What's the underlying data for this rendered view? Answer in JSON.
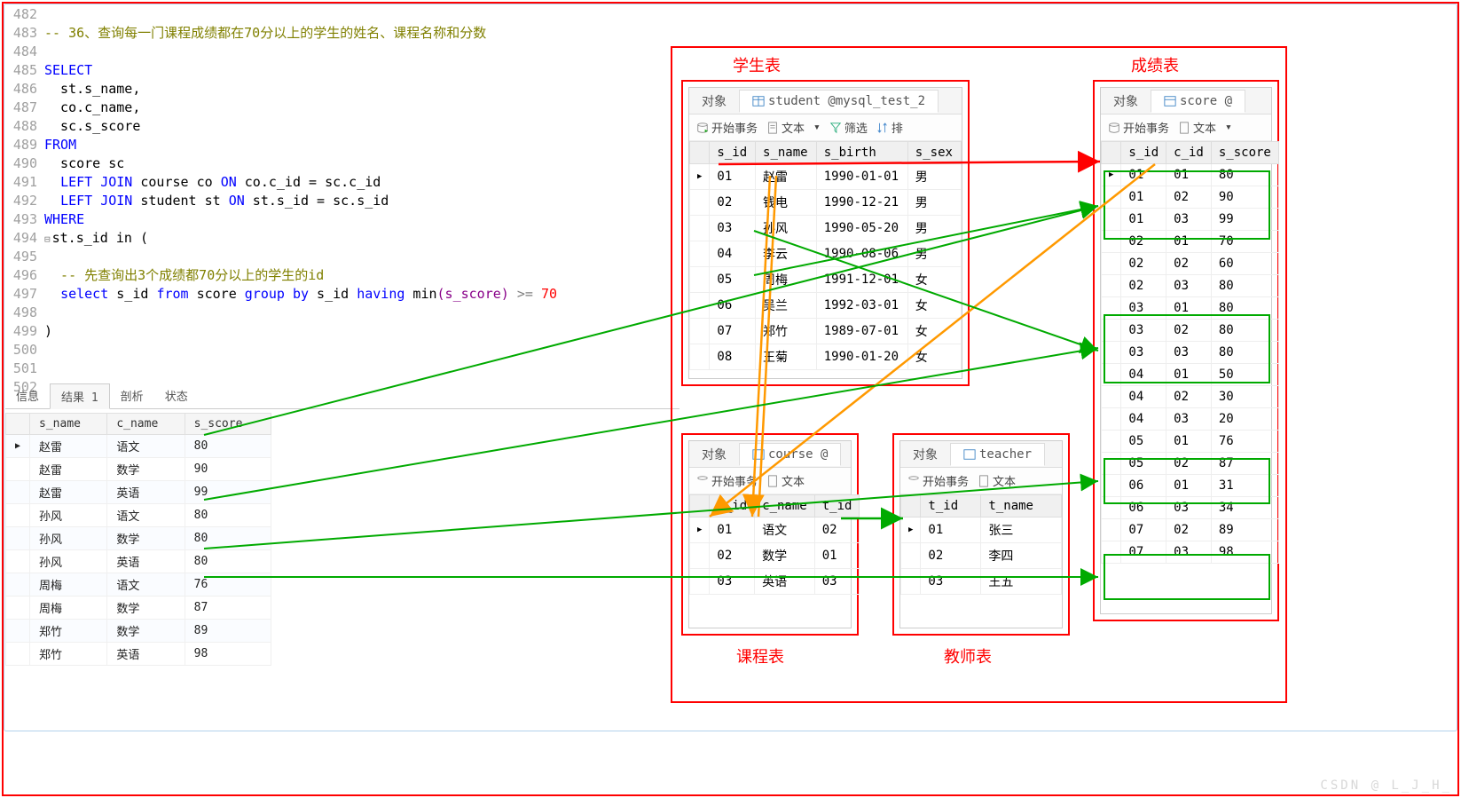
{
  "code": {
    "lines": [
      {
        "n": "482",
        "t": "",
        "cls": ""
      },
      {
        "n": "483",
        "t": "-- 36、查询每一门课程成绩都在70分以上的学生的姓名、课程名称和分数",
        "cls": "cm"
      },
      {
        "n": "484",
        "t": "",
        "cls": ""
      },
      {
        "n": "485",
        "t": "SELECT",
        "cls": "kw"
      },
      {
        "n": "486",
        "t": "  st.s_name,",
        "cls": ""
      },
      {
        "n": "487",
        "t": "  co.c_name,",
        "cls": ""
      },
      {
        "n": "488",
        "t": "  sc.s_score",
        "cls": ""
      },
      {
        "n": "489",
        "t": "FROM",
        "cls": "kw"
      },
      {
        "n": "490",
        "t": "  score sc",
        "cls": ""
      },
      {
        "n": "491",
        "pre": "  ",
        "kw1": "LEFT JOIN",
        "mid": " course co ",
        "kw2": "ON",
        "post": " co.c_id = sc.c_id"
      },
      {
        "n": "492",
        "pre": "  ",
        "kw1": "LEFT JOIN",
        "mid": " student st ",
        "kw2": "ON",
        "post": " st.s_id = sc.s_id"
      },
      {
        "n": "493",
        "t": "WHERE",
        "cls": "kw"
      },
      {
        "n": "494",
        "t": "st.s_id in (",
        "cls": "",
        "collapse": true
      },
      {
        "n": "495",
        "t": "",
        "cls": ""
      },
      {
        "n": "496",
        "t": "  -- 先查询出3个成绩都70分以上的学生的id",
        "cls": "cm"
      },
      {
        "n": "497",
        "sel": true
      },
      {
        "n": "498",
        "t": "",
        "cls": ""
      },
      {
        "n": "499",
        "t": ")",
        "cls": ""
      },
      {
        "n": "500",
        "t": "",
        "cls": ""
      },
      {
        "n": "501",
        "t": "",
        "cls": ""
      },
      {
        "n": "502",
        "t": "",
        "cls": ""
      }
    ],
    "sel_line": {
      "select": "select",
      "s_id": " s_id ",
      "from": "from",
      "score": " score ",
      "group": "group by",
      "s_id2": " s_id ",
      "having": "having",
      "min": " min",
      "paren": "(s_score) ",
      "gte": ">= ",
      "num": "70"
    }
  },
  "tabs": {
    "info": "信息",
    "result1": "结果 1",
    "profile": "剖析",
    "status": "状态"
  },
  "result": {
    "headers": [
      "s_name",
      "c_name",
      "s_score"
    ],
    "rows": [
      [
        "赵雷",
        "语文",
        "80"
      ],
      [
        "赵雷",
        "数学",
        "90"
      ],
      [
        "赵雷",
        "英语",
        "99"
      ],
      [
        "孙风",
        "语文",
        "80"
      ],
      [
        "孙风",
        "数学",
        "80"
      ],
      [
        "孙风",
        "英语",
        "80"
      ],
      [
        "周梅",
        "语文",
        "76"
      ],
      [
        "周梅",
        "数学",
        "87"
      ],
      [
        "郑竹",
        "数学",
        "89"
      ],
      [
        "郑竹",
        "英语",
        "98"
      ]
    ]
  },
  "labels": {
    "student": "学生表",
    "score": "成绩表",
    "course": "课程表",
    "teacher": "教师表",
    "obj": "对象",
    "start_tx": "开始事务",
    "text": "文本",
    "filter": "筛选",
    "sort": "排"
  },
  "student_panel": {
    "tab": "student @mysql_test_2",
    "headers": [
      "s_id",
      "s_name",
      "s_birth",
      "s_sex"
    ],
    "rows": [
      [
        "01",
        "赵雷",
        "1990-01-01",
        "男"
      ],
      [
        "02",
        "钱电",
        "1990-12-21",
        "男"
      ],
      [
        "03",
        "孙风",
        "1990-05-20",
        "男"
      ],
      [
        "04",
        "李云",
        "1990-08-06",
        "男"
      ],
      [
        "05",
        "周梅",
        "1991-12-01",
        "女"
      ],
      [
        "06",
        "吴兰",
        "1992-03-01",
        "女"
      ],
      [
        "07",
        "郑竹",
        "1989-07-01",
        "女"
      ],
      [
        "08",
        "王菊",
        "1990-01-20",
        "女"
      ]
    ]
  },
  "score_panel": {
    "tab": "score @",
    "headers": [
      "s_id",
      "c_id",
      "s_score"
    ],
    "rows": [
      [
        "01",
        "01",
        "80"
      ],
      [
        "01",
        "02",
        "90"
      ],
      [
        "01",
        "03",
        "99"
      ],
      [
        "02",
        "01",
        "70"
      ],
      [
        "02",
        "02",
        "60"
      ],
      [
        "02",
        "03",
        "80"
      ],
      [
        "03",
        "01",
        "80"
      ],
      [
        "03",
        "02",
        "80"
      ],
      [
        "03",
        "03",
        "80"
      ],
      [
        "04",
        "01",
        "50"
      ],
      [
        "04",
        "02",
        "30"
      ],
      [
        "04",
        "03",
        "20"
      ],
      [
        "05",
        "01",
        "76"
      ],
      [
        "05",
        "02",
        "87"
      ],
      [
        "06",
        "01",
        "31"
      ],
      [
        "06",
        "03",
        "34"
      ],
      [
        "07",
        "02",
        "89"
      ],
      [
        "07",
        "03",
        "98"
      ]
    ]
  },
  "course_panel": {
    "tab": "course @",
    "headers": [
      "c_id",
      "c_name",
      "t_id"
    ],
    "rows": [
      [
        "01",
        "语文",
        "02"
      ],
      [
        "02",
        "数学",
        "01"
      ],
      [
        "03",
        "英语",
        "03"
      ]
    ]
  },
  "teacher_panel": {
    "tab": "teacher",
    "headers": [
      "t_id",
      "t_name"
    ],
    "rows": [
      [
        "01",
        "张三"
      ],
      [
        "02",
        "李四"
      ],
      [
        "03",
        "王五"
      ]
    ]
  },
  "watermark": "CSDN @ L_J_H_"
}
